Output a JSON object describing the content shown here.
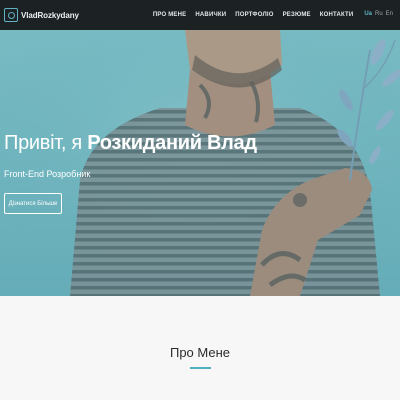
{
  "brand": {
    "name": "VladRozkydany",
    "logo_icon": "camera-icon",
    "accent": "#5fb3c3"
  },
  "nav": {
    "items": [
      "Про мене",
      "Навички",
      "Портфоліо",
      "Резюме",
      "Контакти"
    ]
  },
  "languages": {
    "items": [
      "Ua",
      "Ru",
      "En"
    ],
    "active": "Ua"
  },
  "hero": {
    "greeting": "Привіт, я ",
    "name": "Розкиданий Влад",
    "subtitle": "Front-End Розробник",
    "button_label": "Дізнатися Більше",
    "background_color": "#7bbcc4"
  },
  "about": {
    "title": "Про Мене",
    "accent": "#4fb0bf"
  }
}
